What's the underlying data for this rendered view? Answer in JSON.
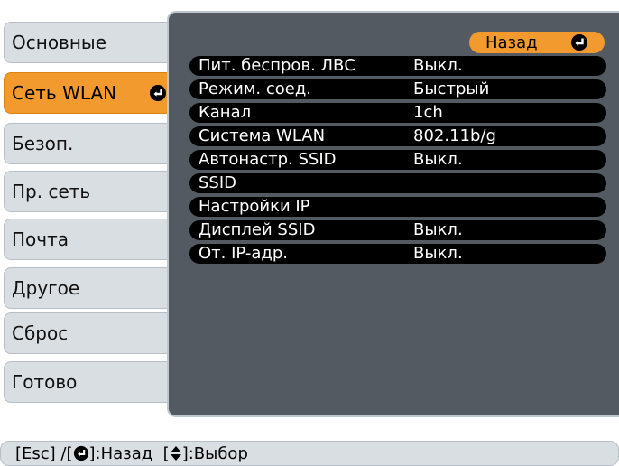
{
  "sidebar": {
    "tabs": [
      {
        "label": "Основные",
        "selected": false
      },
      {
        "label": "Сеть WLAN",
        "selected": true
      },
      {
        "label": "Безоп.",
        "selected": false
      },
      {
        "label": "Пр. сеть",
        "selected": false
      },
      {
        "label": "Почта",
        "selected": false
      },
      {
        "label": "Другое",
        "selected": false
      },
      {
        "label": "Сброс",
        "selected": false
      },
      {
        "label": "Готово",
        "selected": false
      }
    ]
  },
  "panel": {
    "back_label": "Назад",
    "rows": [
      {
        "label": "Пит. беспров. ЛВС",
        "value": "Выкл."
      },
      {
        "label": "Режим. соед.",
        "value": "Быстрый"
      },
      {
        "label": "Канал",
        "value": "1ch"
      },
      {
        "label": "Система WLAN",
        "value": "802.11b/g"
      },
      {
        "label": "Автонастр. SSID",
        "value": "Выкл."
      },
      {
        "label": "SSID",
        "value": ""
      },
      {
        "label": "Настройки IP",
        "value": ""
      },
      {
        "label": "Дисплей SSID",
        "value": "Выкл."
      },
      {
        "label": "От. IP-адр.",
        "value": "Выкл."
      }
    ]
  },
  "help": {
    "part1": "[Esc] /[",
    "part2": "]:Назад  [",
    "part3": "]:Выбор"
  },
  "icons": {
    "enter": "enter-icon",
    "updown": "updown-arrow-icon"
  },
  "colors": {
    "accent": "#f29a2e",
    "panel_bg": "#545a61",
    "row_bg": "#000000",
    "tab_bg": "#d9dee3"
  }
}
